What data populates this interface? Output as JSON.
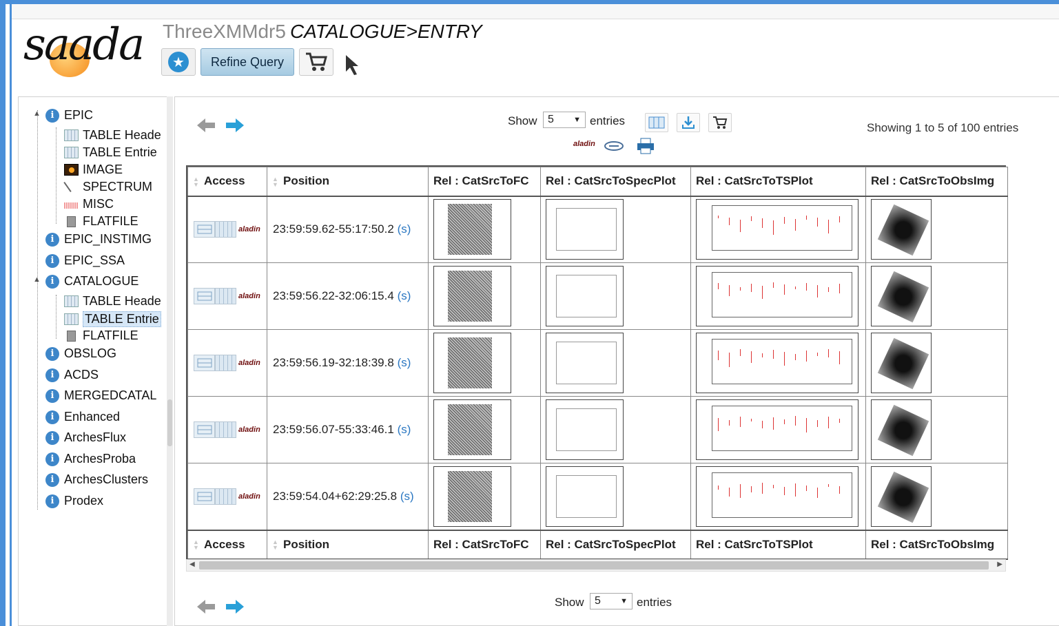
{
  "header": {
    "logo_text": "saada",
    "title_prefix": "ThreeXMMdr5",
    "title_path": "CATALOGUE>ENTRY",
    "refine_label": "Refine Query"
  },
  "tree": [
    {
      "label": "EPIC",
      "type": "node"
    },
    {
      "label": "TABLE Heade",
      "type": "table"
    },
    {
      "label": "TABLE Entrie",
      "type": "table"
    },
    {
      "label": "IMAGE",
      "type": "image"
    },
    {
      "label": "SPECTRUM",
      "type": "spectrum"
    },
    {
      "label": "MISC",
      "type": "misc"
    },
    {
      "label": "FLATFILE",
      "type": "flatfile"
    },
    {
      "label": "EPIC_INSTIMG",
      "type": "node"
    },
    {
      "label": "EPIC_SSA",
      "type": "node"
    },
    {
      "label": "CATALOGUE",
      "type": "node"
    },
    {
      "label": "TABLE Heade",
      "type": "table"
    },
    {
      "label": "TABLE Entrie",
      "type": "table",
      "selected": true
    },
    {
      "label": "FLATFILE",
      "type": "flatfile"
    },
    {
      "label": "OBSLOG",
      "type": "node"
    },
    {
      "label": "ACDS",
      "type": "node"
    },
    {
      "label": "MERGEDCATAL",
      "type": "node"
    },
    {
      "label": "Enhanced",
      "type": "node"
    },
    {
      "label": "ArchesFlux",
      "type": "node"
    },
    {
      "label": "ArchesProba",
      "type": "node"
    },
    {
      "label": "ArchesClusters",
      "type": "node"
    },
    {
      "label": "Prodex",
      "type": "node"
    }
  ],
  "controls": {
    "show_label": "Show",
    "entries_label": "entries",
    "page_size": "5",
    "info": "Showing 1 to 5 of 100 entries",
    "aladin_label": "aladin"
  },
  "table": {
    "columns": [
      "Access",
      "Position",
      "Rel : CatSrcToFC",
      "Rel : CatSrcToSpecPlot",
      "Rel : CatSrcToTSPlot",
      "Rel : CatSrcToObsImg"
    ],
    "rows": [
      {
        "position": "23:59:59.62-55:17:50.2",
        "link": "(s)"
      },
      {
        "position": "23:59:56.22-32:06:15.4",
        "link": "(s)"
      },
      {
        "position": "23:59:56.19-32:18:39.8",
        "link": "(s)"
      },
      {
        "position": "23:59:56.07-55:33:46.1",
        "link": "(s)"
      },
      {
        "position": "23:59:54.04+62:29:25.8",
        "link": "(s)"
      }
    ]
  },
  "icons": {
    "favorite": "star-icon",
    "cart": "cart-icon",
    "samp": "samp-send-icon",
    "prev": "arrow-left-icon",
    "next": "arrow-right-icon",
    "columns": "columns-icon",
    "download": "download-icon",
    "print": "print-icon",
    "aladin": "aladin-icon",
    "link": "link-icon"
  }
}
